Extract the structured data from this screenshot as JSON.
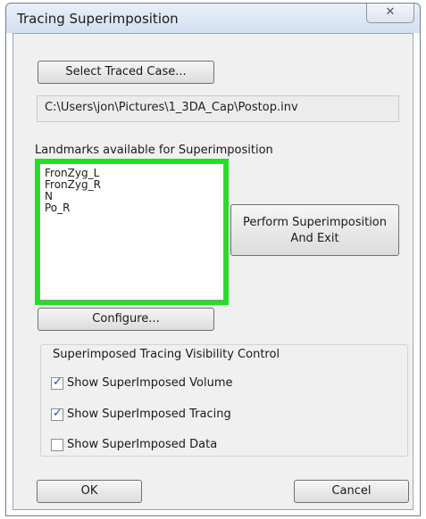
{
  "window": {
    "title": "Tracing Superimposition",
    "close_glyph": "✕"
  },
  "traced_case": {
    "select_button_label": "Select Traced Case...",
    "path_value": "C:\\Users\\jon\\Pictures\\1_3DA_Cap\\Postop.inv"
  },
  "landmarks": {
    "label": "Landmarks available for Superimposition",
    "items": [
      "FronZyg_L",
      "FronZyg_R",
      "N",
      "Po_R"
    ],
    "highlight_color": "#22e022"
  },
  "perform_button": {
    "line1": "Perform Superimposition",
    "line2": "And Exit"
  },
  "configure_button_label": "Configure...",
  "visibility": {
    "group_title": "Superimposed Tracing Visibility Control",
    "options": [
      {
        "label": "Show SuperImposed Volume",
        "checked": true
      },
      {
        "label": "Show SuperImposed Tracing",
        "checked": true
      },
      {
        "label": "Show SuperImposed Data",
        "checked": false
      }
    ]
  },
  "footer": {
    "ok_label": "OK",
    "cancel_label": "Cancel"
  }
}
